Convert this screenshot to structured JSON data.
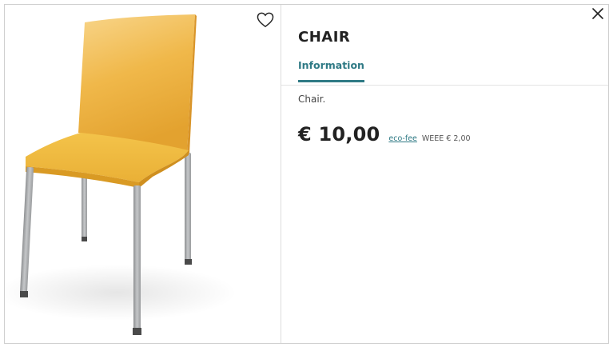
{
  "product": {
    "title": "CHAIR",
    "description": "Chair.",
    "price": "€ 10,00",
    "eco_fee_label": "eco-fee",
    "weee_text": "WEEE € 2,00"
  },
  "tabs": [
    {
      "label": "Information",
      "active": true
    }
  ],
  "icons": {
    "favorite": "heart-icon",
    "close": "close-icon"
  },
  "colors": {
    "accent": "#2f7a85",
    "chair_seat": "#f2b531",
    "chair_legs": "#a9abad"
  }
}
